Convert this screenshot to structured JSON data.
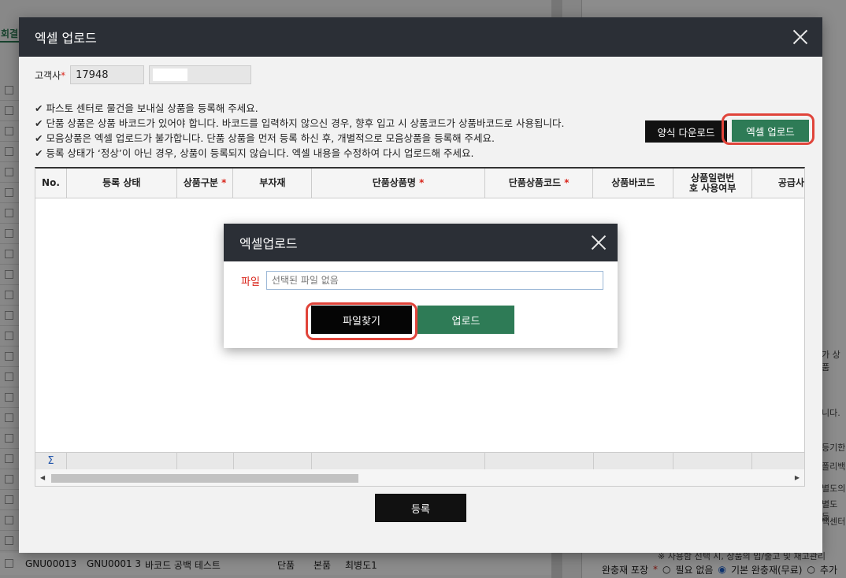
{
  "background": {
    "left_tab": "회결",
    "bottom_row": {
      "code1": "GNU00013",
      "code2": "GNU0001 3",
      "name": "바코드 공백 테스트",
      "type": "단품",
      "kind": "본품",
      "owner": "최병도1"
    },
    "right_texts": [
      "가 상품",
      "니다.",
      "등기한",
      "폴리백",
      "별도의",
      "별도 등",
      "백센터",
      "※ 사용함 선택 시, 상품의 입/출고 및 재고관리"
    ],
    "packing": {
      "label": "완충재 포장",
      "option1": "필요 없음",
      "option2": "기본 완충재(무료)",
      "option3": "추가"
    }
  },
  "modal": {
    "title": "엑셀 업로드",
    "customer_label": "고객사",
    "customer_id": "17948",
    "notices": [
      "파스토 센터로 물건을 보내실 상품을 등록해 주세요.",
      "단품 상품은 상품 바코드가 있어야 합니다. 바코드를 입력하지 않으신 경우, 향후 입고 시 상품코드가 상품바코드로 사용됩니다.",
      "모음상품은 엑셀 업로드가 불가합니다. 단품 상품을 먼저 등록 하신 후, 개별적으로 모음상품을 등록해 주세요.",
      "등록 상태가 ‘정상’이 아닌 경우, 상품이 등록되지 않습니다. 엑셀 내용을 수정하여 다시 업로드해 주세요."
    ],
    "template_download_label": "양식 다운로드",
    "excel_upload_label": "엑셀 업로드",
    "grid": {
      "columns": [
        "No.",
        "등록 상태",
        "상품구분",
        "부자재",
        "단품상품명",
        "단품상품코드",
        "상품바코드",
        "상품일련번호 사용여부",
        "공급사"
      ],
      "sigma": "Σ"
    },
    "register_label": "등록"
  },
  "submodal": {
    "title": "엑셀업로드",
    "file_label": "파일",
    "file_placeholder": "선택된 파일 없음",
    "find_label": "파일찾기",
    "upload_label": "업로드"
  }
}
